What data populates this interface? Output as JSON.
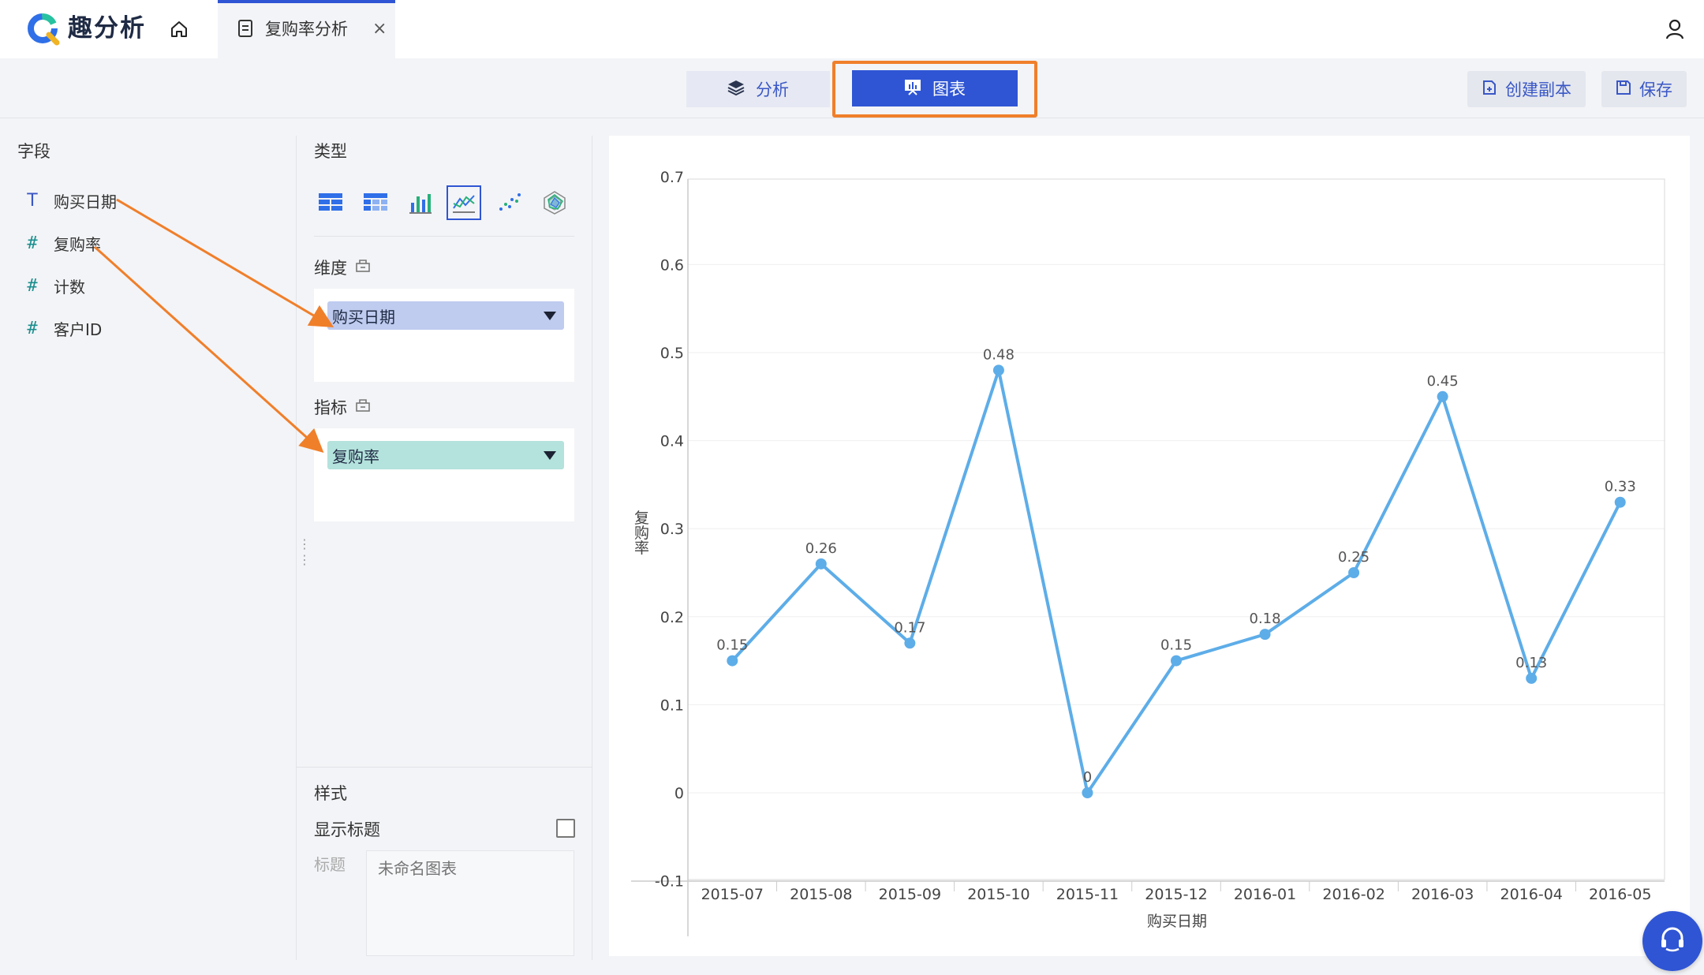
{
  "app": {
    "name": "趣分析"
  },
  "tabs": [
    {
      "label": "复购率分析",
      "close": "×"
    }
  ],
  "modes": {
    "analysis": "分析",
    "chart": "图表",
    "active": "chart"
  },
  "actions": {
    "copy": "创建副本",
    "save": "保存"
  },
  "fields": {
    "title": "字段",
    "items": [
      {
        "type": "T",
        "label": "购买日期"
      },
      {
        "type": "#",
        "label": "复购率"
      },
      {
        "type": "#",
        "label": "计数"
      },
      {
        "type": "#",
        "label": "客户ID"
      }
    ]
  },
  "config": {
    "type_title": "类型",
    "chart_types": [
      "table-icon",
      "pivot-table-icon",
      "bar-chart-icon",
      "line-chart-icon",
      "scatter-chart-icon",
      "radar-chart-icon"
    ],
    "active_type": "line-chart-icon",
    "dimension_title": "维度",
    "dimension_value": "购买日期",
    "metric_title": "指标",
    "metric_value": "复购率",
    "style_title": "样式",
    "show_title_label": "显示标题",
    "show_title_checked": false,
    "title_label": "标题",
    "title_placeholder": "未命名图表"
  },
  "colors": {
    "accent": "#2f55d4",
    "line": "#5dade8",
    "annotation": "#f07f2a"
  },
  "chart_data": {
    "type": "line",
    "title": "",
    "xlabel": "购买日期",
    "ylabel": "复购率",
    "categories": [
      "2015-07",
      "2015-08",
      "2015-09",
      "2015-10",
      "2015-11",
      "2015-12",
      "2016-01",
      "2016-02",
      "2016-03",
      "2016-04",
      "2016-05"
    ],
    "values": [
      0.15,
      0.26,
      0.17,
      0.48,
      0,
      0.15,
      0.18,
      0.25,
      0.45,
      0.13,
      0.33
    ],
    "data_labels": [
      "0.15",
      "0.26",
      "0.17",
      "0.48",
      "0",
      "0.15",
      "0.18",
      "0.25",
      "0.45",
      "0.13",
      "0.33"
    ],
    "yticks": [
      0.7,
      0.6,
      0.5,
      0.4,
      0.3,
      0.2,
      0.1,
      0,
      -0.1
    ],
    "ylim": [
      -0.1,
      0.7
    ],
    "grid": true,
    "legend": "none"
  }
}
